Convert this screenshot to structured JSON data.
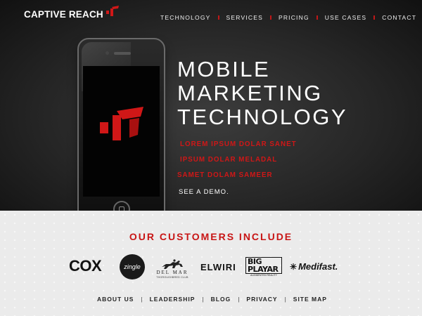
{
  "brand": {
    "name": "CAPTIVE REACH",
    "accent": "#d01717"
  },
  "nav": {
    "items": [
      "TECHNOLOGY",
      "SERVICES",
      "PRICING",
      "USE CASES",
      "CONTACT"
    ]
  },
  "hero": {
    "headline": [
      "MOBILE",
      "MARKETING",
      "TECHNOLOGY"
    ],
    "red_lines": [
      "LOREM IPSUM DOLAR SANET",
      "IPSUM DOLAR MELADAL",
      "SAMET DOLAM SAMEER"
    ],
    "cta": "SEE A DEMO."
  },
  "customers": {
    "title": "OUR CUSTOMERS INCLUDE",
    "logos": {
      "cox": "COX",
      "zingle": "zingle",
      "delmar_name": "DEL MAR",
      "delmar_sub": "THOROUGHBRED CLUB",
      "elwiri": "ELWIRI",
      "bigplayar_main": "BIG PLAYAR",
      "bigplayar_sub": "AUGMENTED REALITY",
      "medifast": "Medifast."
    }
  },
  "footer": {
    "items": [
      "ABOUT US",
      "LEADERSHIP",
      "BLOG",
      "PRIVACY",
      "SITE MAP"
    ]
  }
}
